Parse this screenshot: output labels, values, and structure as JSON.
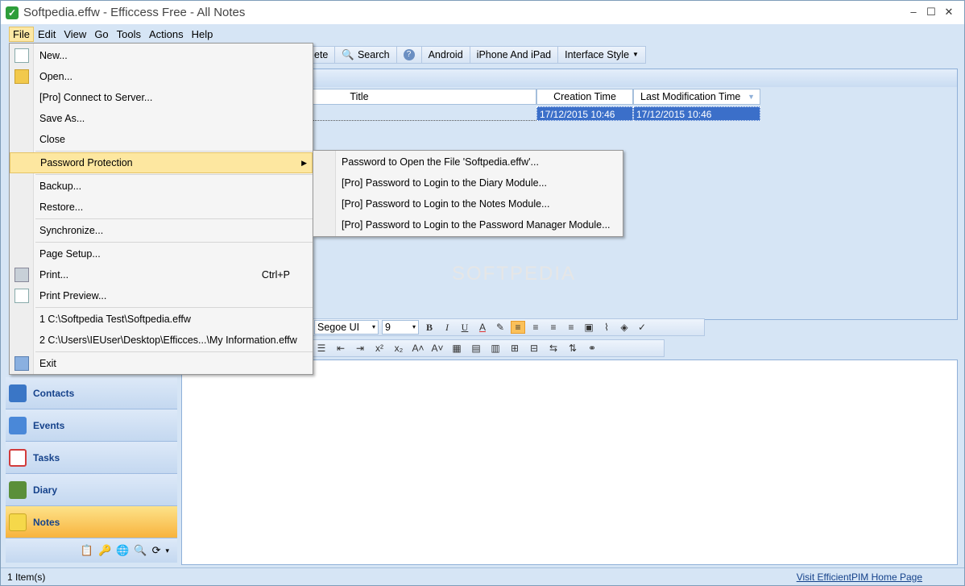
{
  "window": {
    "title": "Softpedia.effw - Efficcess Free - All Notes",
    "minimize": "–",
    "maximize": "☐",
    "close": "✕"
  },
  "menubar": [
    "File",
    "Edit",
    "View",
    "Go",
    "Tools",
    "Actions",
    "Help"
  ],
  "toolbar": {
    "delete_partial": "ete",
    "search": "Search",
    "help_icon": "?",
    "android": "Android",
    "iphone": "iPhone And iPad",
    "interface_style": "Interface Style"
  },
  "grid": {
    "columns": [
      "Title",
      "Creation Time",
      "Last Modification Time"
    ],
    "rows": [
      {
        "title": "",
        "created": "17/12/2015 10:46",
        "modified": "17/12/2015 10:46"
      }
    ]
  },
  "watermark": "SOFTPEDIA",
  "editor_toolbar": {
    "font": "Segoe UI",
    "size": "9",
    "bold": "B",
    "italic": "I",
    "underline": "U",
    "font_color": "A",
    "superscript": "x²",
    "subscript": "x₂"
  },
  "sidebar": {
    "items": [
      {
        "label": "Contacts",
        "color": "#3a76c6"
      },
      {
        "label": "Events",
        "color": "#4a88d8"
      },
      {
        "label": "Tasks",
        "color": "#d23c3c"
      },
      {
        "label": "Diary",
        "color": "#5a8f3a"
      },
      {
        "label": "Notes",
        "color": "#f5d84a"
      }
    ],
    "active": "Notes"
  },
  "file_menu": {
    "items": [
      {
        "label": "New...",
        "shortcut": ""
      },
      {
        "label": "Open...",
        "shortcut": ""
      },
      {
        "label": "[Pro] Connect to Server...",
        "shortcut": ""
      },
      {
        "label": "Save As...",
        "shortcut": ""
      },
      {
        "label": "Close",
        "shortcut": ""
      },
      {
        "label": "Password Protection",
        "shortcut": ""
      },
      {
        "label": "Backup...",
        "shortcut": ""
      },
      {
        "label": "Restore...",
        "shortcut": ""
      },
      {
        "label": "Synchronize...",
        "shortcut": ""
      },
      {
        "label": "Page Setup...",
        "shortcut": ""
      },
      {
        "label": "Print...",
        "shortcut": "Ctrl+P"
      },
      {
        "label": "Print Preview...",
        "shortcut": ""
      },
      {
        "label": "1 C:\\Softpedia Test\\Softpedia.effw",
        "shortcut": ""
      },
      {
        "label": "2 C:\\Users\\IEUser\\Desktop\\Efficces...\\My Information.effw",
        "shortcut": ""
      },
      {
        "label": "Exit",
        "shortcut": ""
      }
    ]
  },
  "password_submenu": [
    "Password to Open the File 'Softpedia.effw'...",
    "[Pro] Password to Login to the Diary Module...",
    "[Pro] Password to Login to the Notes Module...",
    "[Pro] Password to Login to the Password Manager Module..."
  ],
  "status": {
    "items": "1 Item(s)",
    "link": "Visit EfficientPIM Home Page"
  }
}
